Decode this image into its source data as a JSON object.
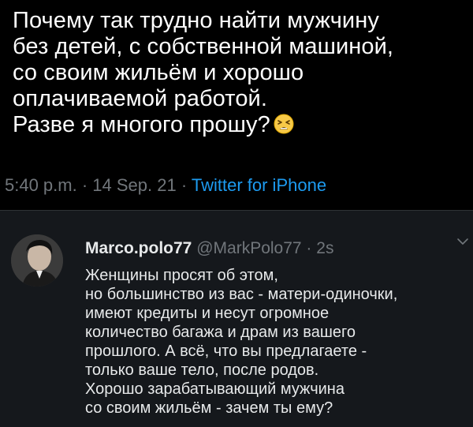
{
  "tweet": {
    "lines": [
      "Почему так трудно найти мужчину",
      "без детей, с собственной машиной,",
      "со своим жильём и хорошо",
      "оплачиваемой работой.",
      "Разве я многого прошу?"
    ],
    "emoji": "tired-face-emoji",
    "time": "5:40 p.m.",
    "separator": " · ",
    "date": "14 Sep. 21",
    "source": "Twitter for iPhone"
  },
  "reply": {
    "display_name": "Marco.polo77",
    "handle": "@MarkPolo77",
    "separator": " · ",
    "age": "2s",
    "more_icon": "chevron-down-icon",
    "lines": [
      "Женщины просят об этом,",
      "но большинство из вас - матери-одиночки,",
      "имеют кредиты и несут огромное",
      "количество багажа и драм из вашего",
      "прошлого. А всё, что вы предлагаете -",
      "только ваше тело, после родов.",
      "Хорошо зарабатывающий мужчина",
      "со своим жильём - зачем ты ему?"
    ]
  },
  "colors": {
    "background": "#000000",
    "reply_background": "#15181c",
    "text": "#ffffff",
    "muted": "#71767b",
    "link": "#1d9bf0"
  }
}
